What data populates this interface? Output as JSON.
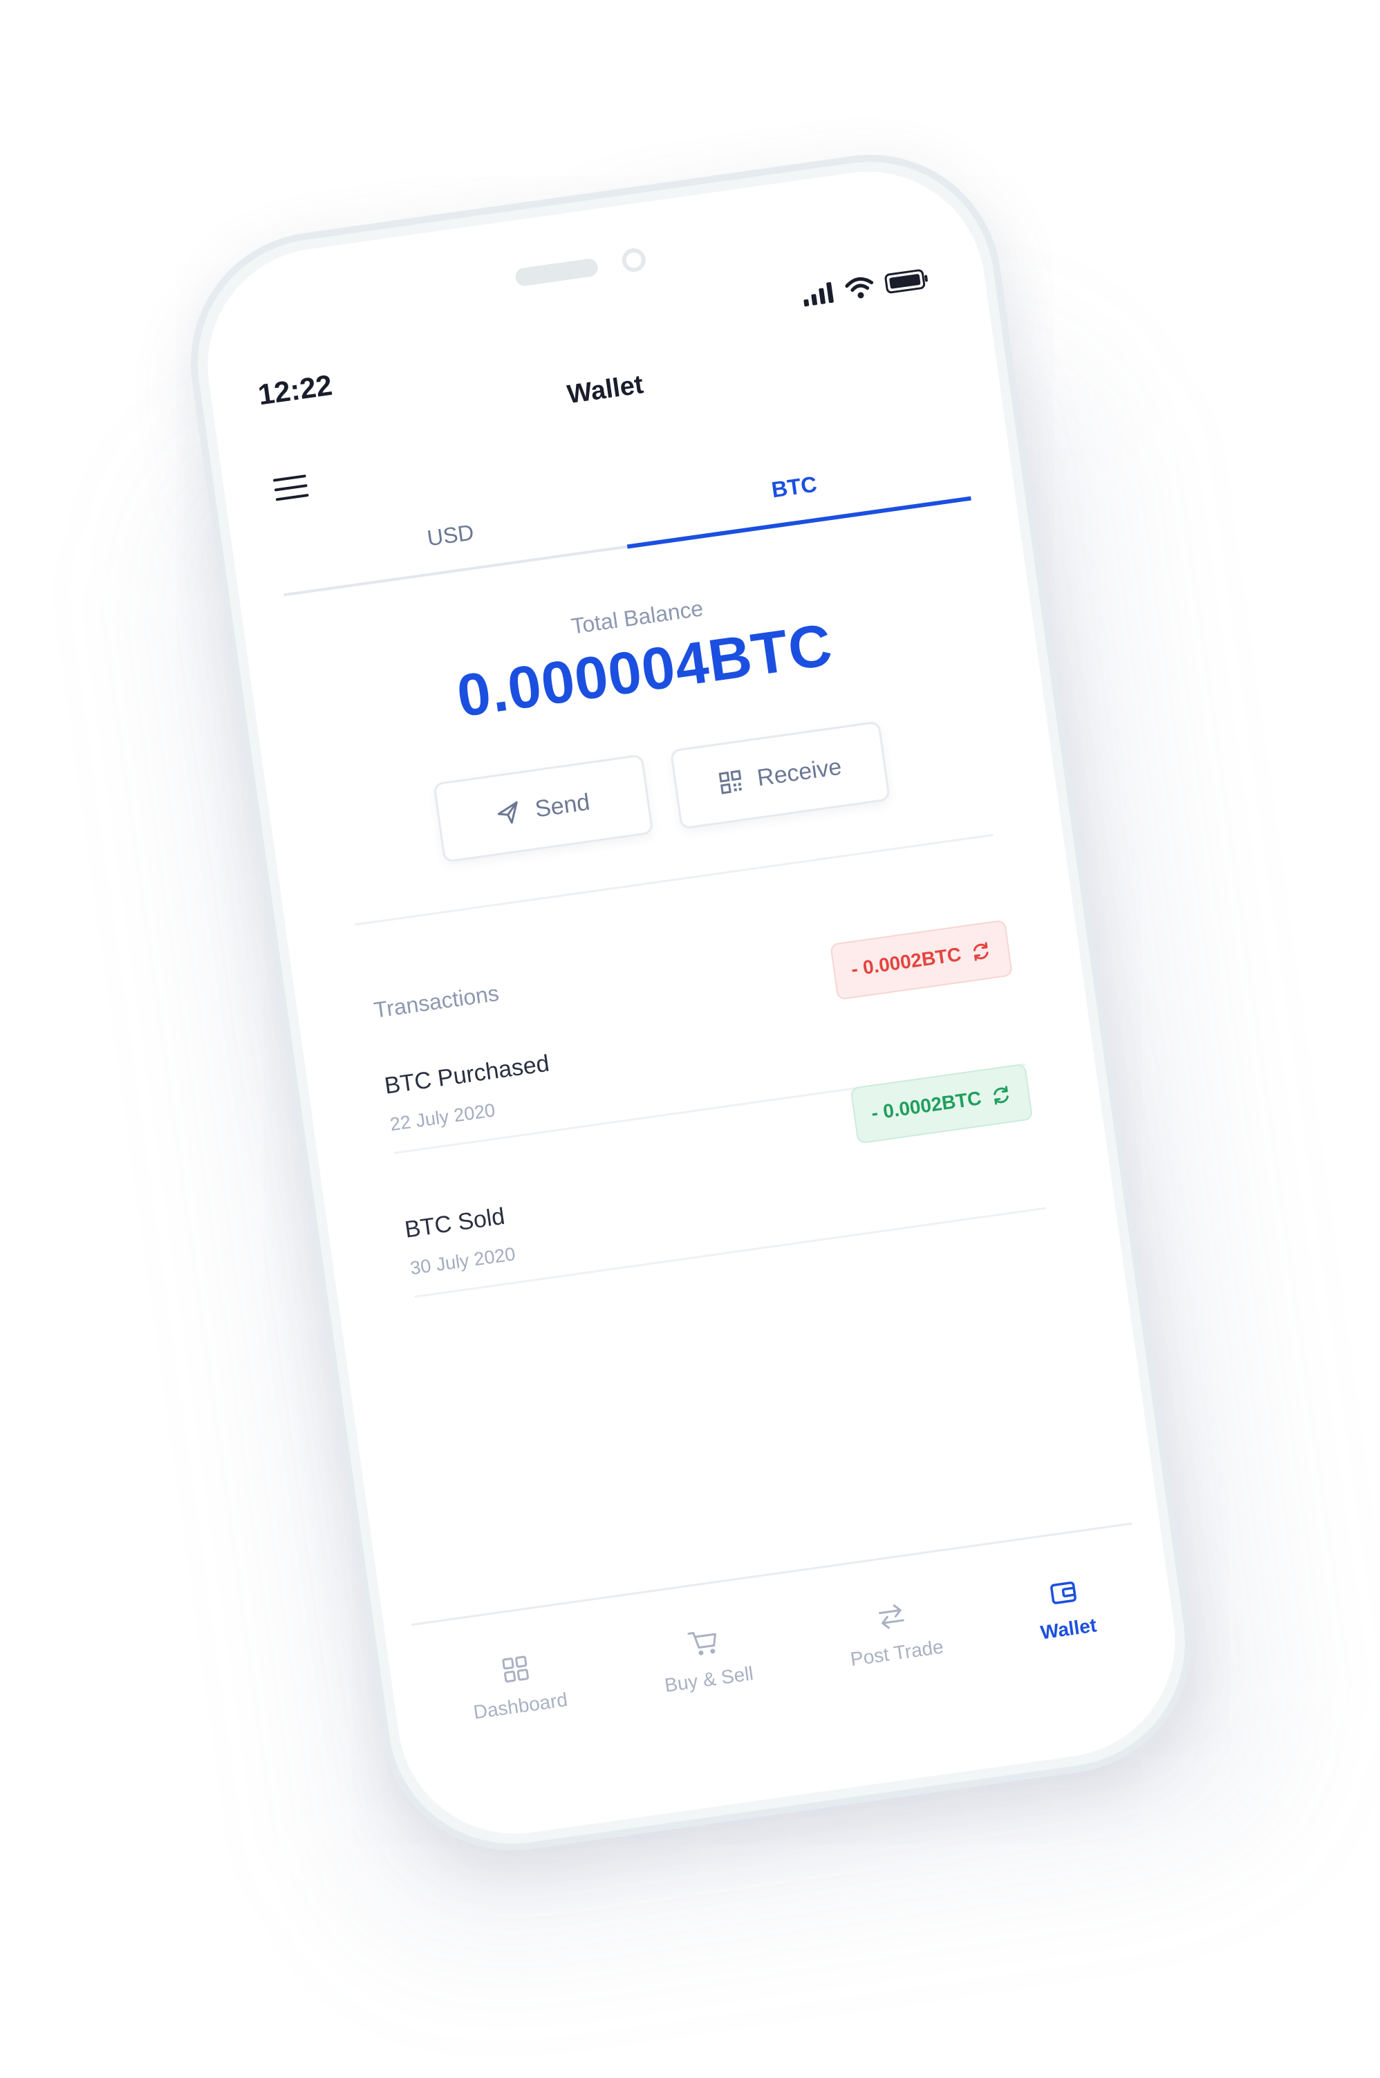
{
  "status_bar": {
    "time": "12:22",
    "icons": [
      "signal-icon",
      "wifi-icon",
      "battery-icon"
    ]
  },
  "header": {
    "title": "Wallet",
    "menu_icon": "hamburger-menu-icon"
  },
  "tabs": [
    {
      "label": "USD",
      "active": false
    },
    {
      "label": "BTC",
      "active": true
    }
  ],
  "balance": {
    "label": "Total Balance",
    "value": "0.000004BTC"
  },
  "actions": {
    "send_label": "Send",
    "send_icon": "paper-plane-icon",
    "receive_label": "Receive",
    "receive_icon": "qr-code-icon"
  },
  "transactions": {
    "section_label": "Transactions",
    "items": [
      {
        "title": "BTC Purchased",
        "date": "22 July 2020",
        "amount": "- 0.0002BTC",
        "status": "negative",
        "icon": "refresh-icon"
      },
      {
        "title": "BTC Sold",
        "date": "30 July 2020",
        "amount": "- 0.0002BTC",
        "status": "positive",
        "icon": "refresh-icon"
      }
    ]
  },
  "bottom_nav": [
    {
      "label": "Dashboard",
      "icon": "grid-icon",
      "active": false
    },
    {
      "label": "Buy & Sell",
      "icon": "cart-icon",
      "active": false
    },
    {
      "label": "Post Trade",
      "icon": "swap-arrows-icon",
      "active": false
    },
    {
      "label": "Wallet",
      "icon": "wallet-icon",
      "active": true
    }
  ],
  "colors": {
    "accent": "#1b4fe0",
    "negative": "#e5433e",
    "positive": "#1f9f5c",
    "muted": "#8d98b0"
  }
}
